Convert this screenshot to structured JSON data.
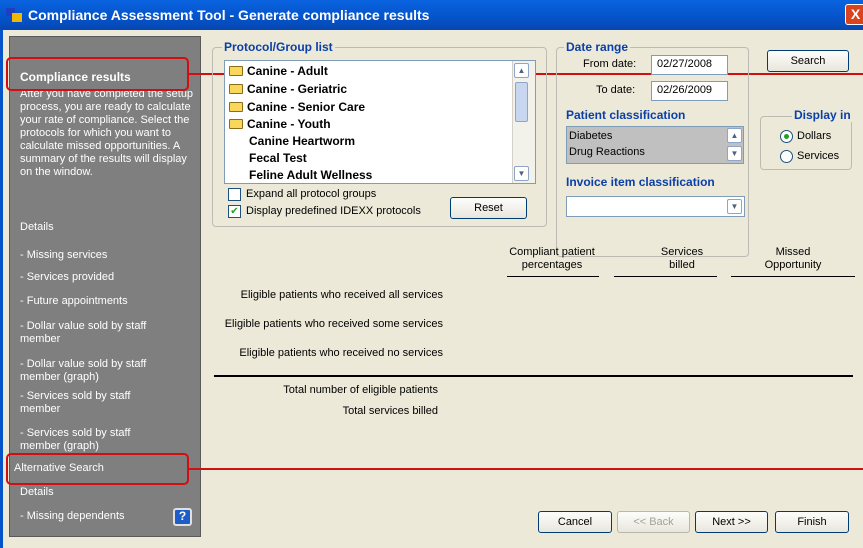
{
  "window": {
    "title": "Compliance Assessment Tool - Generate compliance results",
    "close_glyph": "X"
  },
  "left_panel": {
    "title": "Compliance results",
    "description": "After you have completed the setup process, you are ready to calculate your rate of compliance. Select the protocols for which you want to calculate missed opportunities. A summary of the results will display on the window.",
    "details_heading": "Details",
    "details_items": [
      "- Missing services",
      "- Services provided",
      "- Future appointments",
      "- Dollar value sold by staff member",
      "- Dollar value sold by staff member (graph)",
      "- Services sold by staff member",
      "- Services sold by staff member (graph)"
    ],
    "alt_heading": "Alternative Search",
    "alt_details_heading": "Details",
    "alt_items": [
      "- Missing dependents"
    ],
    "help_glyph": "?"
  },
  "protocol_group": {
    "legend": "Protocol/Group list",
    "items": [
      {
        "label": "Canine - Adult",
        "folder": true
      },
      {
        "label": "Canine - Geriatric",
        "folder": true
      },
      {
        "label": "Canine - Senior Care",
        "folder": true
      },
      {
        "label": "Canine - Youth",
        "folder": true
      },
      {
        "label": "Canine Heartworm",
        "folder": false
      },
      {
        "label": "Fecal Test",
        "folder": false
      },
      {
        "label": "Feline Adult Wellness",
        "folder": false
      }
    ],
    "expand_all_label": "Expand all protocol groups",
    "expand_all_checked": false,
    "display_predefined_label": "Display predefined IDEXX protocols",
    "display_predefined_checked": true,
    "reset_label": "Reset"
  },
  "date_range": {
    "legend": "Date range",
    "from_label": "From date:",
    "from_value": "02/27/2008",
    "to_label": "To date:",
    "to_value": "02/26/2009"
  },
  "patient_classification": {
    "legend": "Patient classification",
    "items": [
      "Diabetes",
      "Drug Reactions"
    ]
  },
  "invoice_classification": {
    "legend": "Invoice item classification",
    "value": ""
  },
  "search_label": "Search",
  "display_in": {
    "legend": "Display in",
    "options": [
      "Dollars",
      "Services"
    ],
    "selected": "Dollars"
  },
  "results": {
    "columns": [
      "Compliant patient percentages",
      "Services billed",
      "Missed Opportunity"
    ],
    "rows": [
      "Eligible patients who received all services",
      "Eligible patients who received some services",
      "Eligible patients who received no services"
    ],
    "totals": [
      "Total number of eligible patients",
      "Total services billed"
    ]
  },
  "footer": {
    "cancel": "Cancel",
    "back": "<< Back",
    "next": "Next >>",
    "finish": "Finish"
  },
  "icons": {
    "folder": "folder-icon",
    "checkmark": "✔",
    "scroll_up": "▲",
    "scroll_down": "▼"
  },
  "colors": {
    "title_bar": "#0553c9",
    "panel_bg": "#ece9d8",
    "left_panel_bg": "#7f7f7f",
    "legend_text": "#0a3fa8",
    "callout": "#d01010"
  }
}
